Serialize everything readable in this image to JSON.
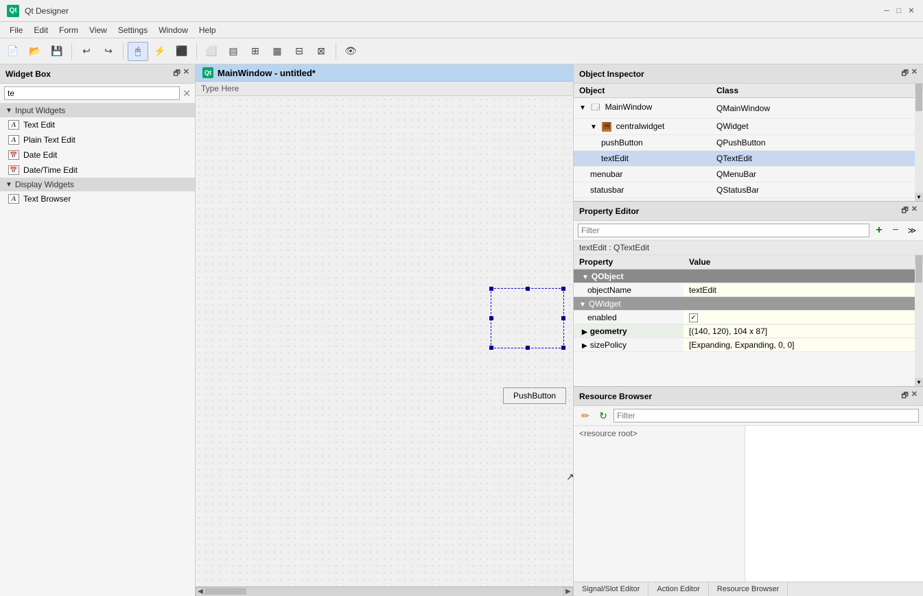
{
  "app": {
    "title": "Qt Designer",
    "icon_label": "Qt"
  },
  "window_controls": {
    "minimize": "─",
    "maximize": "□",
    "close": "✕"
  },
  "menu": {
    "items": [
      "File",
      "Edit",
      "Form",
      "View",
      "Settings",
      "Window",
      "Help"
    ]
  },
  "widget_box": {
    "title": "Widget Box",
    "search_value": "te",
    "sections": [
      {
        "label": "Input Widgets",
        "items": [
          {
            "label": "Text Edit",
            "icon": "A"
          },
          {
            "label": "Plain Text Edit",
            "icon": "A"
          },
          {
            "label": "Date Edit",
            "icon": "cal"
          },
          {
            "label": "Date/Time Edit",
            "icon": "cal"
          }
        ]
      },
      {
        "label": "Display Widgets",
        "items": [
          {
            "label": "Text Browser",
            "icon": "A"
          }
        ]
      }
    ]
  },
  "canvas": {
    "title": "MainWindow - untitled*",
    "qt_icon": "Qt",
    "menu_placeholder": "Type Here",
    "push_button_label": "PushButton"
  },
  "object_inspector": {
    "title": "Object Inspector",
    "columns": [
      "Object",
      "Class"
    ],
    "rows": [
      {
        "indent": 0,
        "arrow": "▼",
        "icon": "win",
        "object": "MainWindow",
        "class": "QMainWindow"
      },
      {
        "indent": 1,
        "arrow": "▼",
        "icon": "img",
        "object": "centralwidget",
        "class": "QWidget"
      },
      {
        "indent": 2,
        "arrow": null,
        "icon": null,
        "object": "pushButton",
        "class": "QPushButton"
      },
      {
        "indent": 2,
        "arrow": null,
        "icon": null,
        "object": "textEdit",
        "class": "QTextEdit",
        "selected": true
      },
      {
        "indent": 1,
        "arrow": null,
        "icon": null,
        "object": "menubar",
        "class": "QMenuBar"
      },
      {
        "indent": 1,
        "arrow": null,
        "icon": null,
        "object": "statusbar",
        "class": "QStatusBar"
      }
    ]
  },
  "property_editor": {
    "title": "Property Editor",
    "filter_placeholder": "Filter",
    "context_label": "textEdit : QTextEdit",
    "columns": [
      "Property",
      "Value"
    ],
    "rows": [
      {
        "type": "section",
        "property": "QObject",
        "value": ""
      },
      {
        "type": "normal",
        "indent": 1,
        "property": "objectName",
        "value": "textEdit"
      },
      {
        "type": "subsection",
        "property": "QWidget",
        "value": ""
      },
      {
        "type": "normal",
        "indent": 1,
        "property": "enabled",
        "value": "☑",
        "is_checkbox": true
      },
      {
        "type": "highlighted",
        "indent": 1,
        "arrow": "▶",
        "property": "geometry",
        "value": "[(140, 120), 104 x 87]"
      },
      {
        "type": "normal",
        "indent": 1,
        "arrow": "▶",
        "property": "sizePolicy",
        "value": "[Expanding, Expanding, 0, 0]"
      }
    ],
    "add_btn": "+",
    "remove_btn": "−",
    "more_btn": "≫"
  },
  "resource_browser": {
    "title": "Resource Browser",
    "filter_placeholder": "Filter",
    "pencil_icon": "✏",
    "refresh_icon": "↻",
    "tree_item": "<resource root>"
  },
  "bottom_tabs": {
    "tabs": [
      "Signal/Slot Editor",
      "Action Editor",
      "Resource Browser"
    ]
  }
}
